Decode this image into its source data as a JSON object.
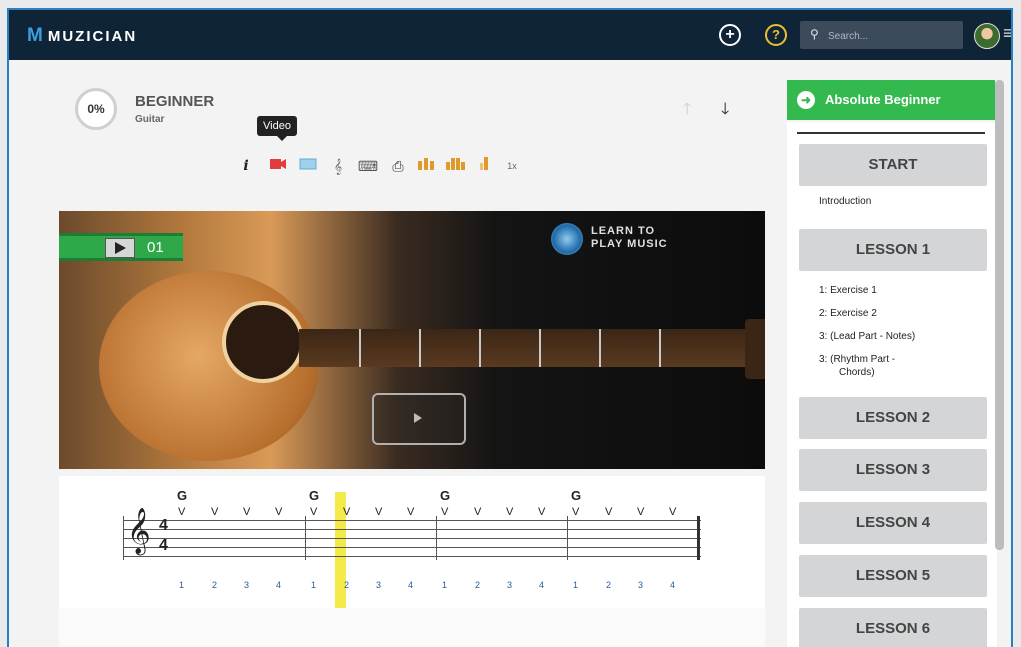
{
  "app": {
    "brand_letter": "M",
    "brand_name": "MUZICIAN"
  },
  "topbar": {
    "plus_icon": "+",
    "help_icon": "?",
    "search_placeholder": "Search...",
    "search_icon": "magnifier-icon",
    "menu_icon": "≡"
  },
  "course": {
    "progress": "0%",
    "title": "BEGINNER",
    "subtitle": "Guitar",
    "tooltip": "Video",
    "speed": "1x"
  },
  "video": {
    "lesson_number": "01",
    "brand_line1": "LEARN TO",
    "brand_line2": "PLAY MUSIC"
  },
  "notation": {
    "chords": [
      "G",
      "G",
      "G",
      "G"
    ],
    "strum_mark": "V",
    "beats": [
      "1",
      "2",
      "3",
      "4"
    ]
  },
  "sidebar": {
    "course_button": "Absolute Beginner",
    "sections": [
      {
        "label": "START",
        "items": [
          "Introduction"
        ]
      },
      {
        "label": "LESSON 1",
        "items": [
          "1: Exercise 1",
          "2: Exercise 2",
          "3: (Lead Part - Notes)",
          "3: (Rhythm Part -",
          "Chords)"
        ]
      },
      {
        "label": "LESSON 2"
      },
      {
        "label": "LESSON 3"
      },
      {
        "label": "LESSON 4"
      },
      {
        "label": "LESSON 5"
      },
      {
        "label": "LESSON 6"
      }
    ]
  },
  "colors": {
    "topbar": "#0f2437",
    "accent_green": "#33b94d",
    "highlight": "#f4ea4a",
    "frame_border": "#2a7fc1"
  }
}
